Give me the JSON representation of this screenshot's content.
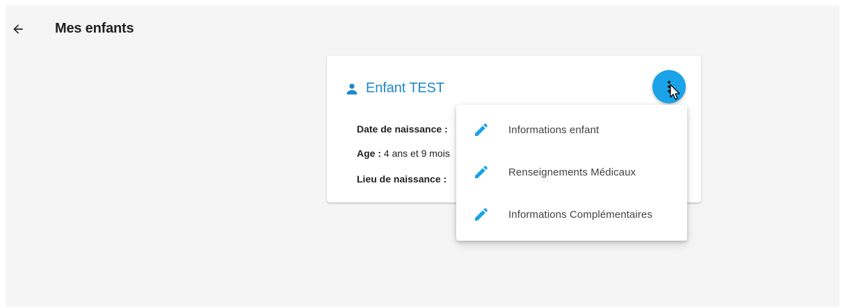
{
  "header": {
    "back_icon": "arrow-left-icon",
    "title": "Mes enfants"
  },
  "child_card": {
    "icon": "person-icon",
    "name": "Enfant TEST",
    "birth_date_label": "Date de naissance :",
    "age_label": "Age :",
    "age_value": "4 ans et 9 mois",
    "birth_place_label": "Lieu de naissance :",
    "menu_button_icon": "more-vertical-icon"
  },
  "menu": {
    "items": [
      {
        "icon": "pencil-icon",
        "label": "Informations enfant"
      },
      {
        "icon": "pencil-icon",
        "label": "Renseignements Médicaux"
      },
      {
        "icon": "pencil-icon",
        "label": "Informations Complémentaires"
      }
    ]
  },
  "colors": {
    "accent": "#1aa3e8",
    "title_blue": "#1e88c9",
    "background": "#f5f5f5",
    "card": "#ffffff"
  }
}
